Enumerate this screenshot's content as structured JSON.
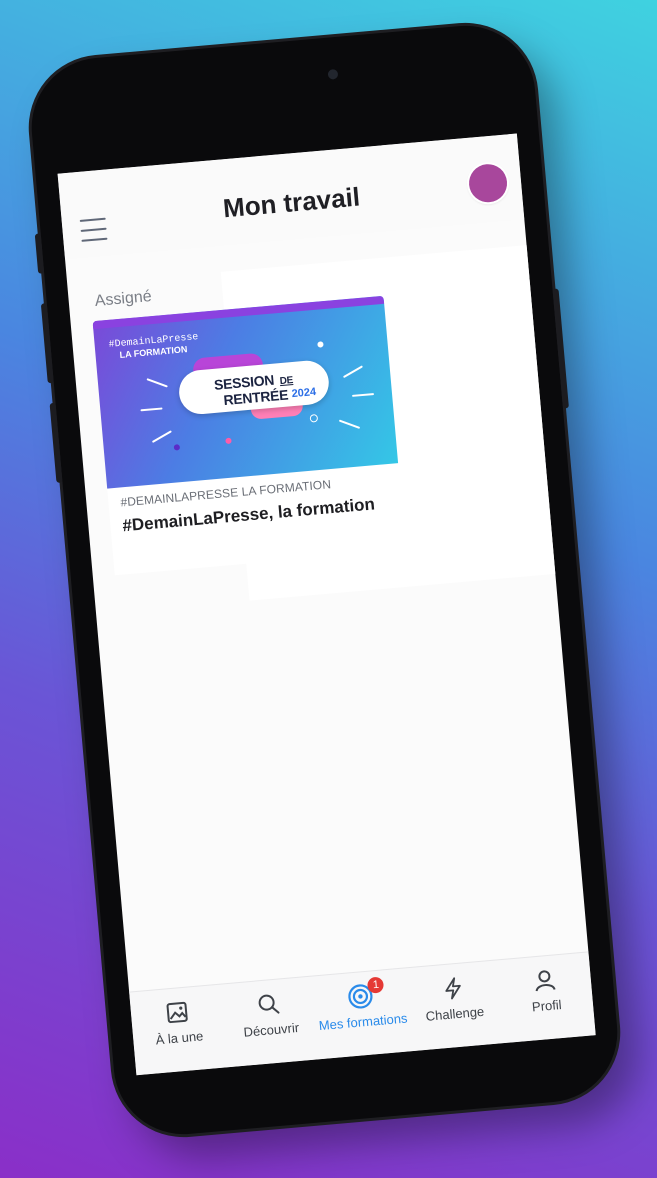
{
  "header": {
    "title": "Mon travail",
    "menu_icon": "hamburger-menu-icon",
    "avatar_color": "#a8479c"
  },
  "section": {
    "label": "Assigné"
  },
  "course": {
    "image": {
      "brand": "#DemainLaPresse",
      "brand_sub": "LA FORMATION",
      "headline_part1": "SESSION",
      "headline_de": "DE",
      "headline_part2": "RENTRÉE",
      "year": "2024"
    },
    "category": "#DEMAINLAPRESSE LA FORMATION",
    "title": "#DemainLaPresse, la formation"
  },
  "bottom_nav": {
    "items": [
      {
        "label": "À la une",
        "icon": "image-icon",
        "active": false
      },
      {
        "label": "Découvrir",
        "icon": "search-icon",
        "active": false
      },
      {
        "label": "Mes formations",
        "icon": "target-icon",
        "active": true,
        "badge": "1"
      },
      {
        "label": "Challenge",
        "icon": "lightning-icon",
        "active": false
      },
      {
        "label": "Profil",
        "icon": "person-icon",
        "active": false
      }
    ]
  },
  "colors": {
    "accent": "#2a8bea",
    "badge": "#e53935"
  }
}
